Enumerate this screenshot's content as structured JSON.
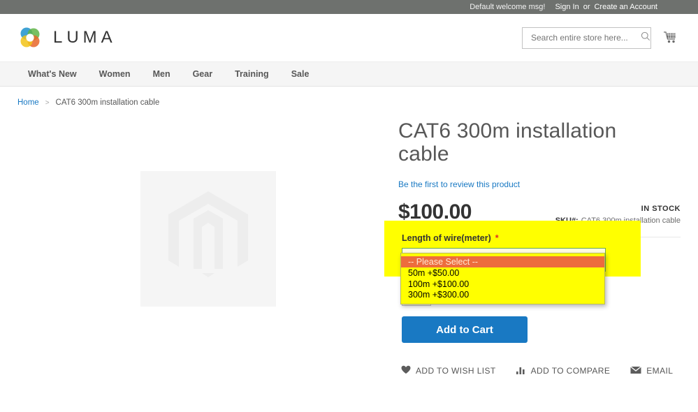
{
  "top_panel": {
    "welcome": "Default welcome msg!",
    "sign_in": "Sign In",
    "or": "or",
    "create_account": "Create an Account"
  },
  "header": {
    "brand": "LUMA",
    "search": {
      "placeholder": "Search entire store here...",
      "value": "",
      "icon": "search-icon"
    },
    "cart_icon": "shopping-cart-icon"
  },
  "nav": {
    "items": [
      {
        "label": "What's New"
      },
      {
        "label": "Women"
      },
      {
        "label": "Men"
      },
      {
        "label": "Gear"
      },
      {
        "label": "Training"
      },
      {
        "label": "Sale"
      }
    ]
  },
  "breadcrumb": {
    "home": "Home",
    "separator": ">",
    "current": "CAT6 300m installation cable"
  },
  "product": {
    "title": "CAT6 300m installation cable",
    "review_link": "Be the first to review this product",
    "price": "$100.00",
    "stock_status": "IN STOCK",
    "sku_label": "SKU#:",
    "sku_value": "CAT6 300m installation cable",
    "gallery_placeholder_icon": "magento-placeholder-icon"
  },
  "options": {
    "label": "Length of wire(meter)",
    "required_mark": "*",
    "select": {
      "selected_value": "-- Please Select --",
      "open": true,
      "options": [
        {
          "label": "-- Please Select --",
          "selected": true
        },
        {
          "label": "50m +$50.00",
          "selected": false
        },
        {
          "label": "100m +$100.00",
          "selected": false
        },
        {
          "label": "300m +$300.00",
          "selected": false
        }
      ]
    },
    "highlight_color": "#ffff00",
    "selected_option_color": "#ed6c3d",
    "focus_border_color": "#6aa84f"
  },
  "quantity": {
    "value": ""
  },
  "actions": {
    "add_to_cart": "Add to Cart",
    "add_to_cart_color": "#1979c3",
    "wishlist": "ADD TO WISH LIST",
    "wishlist_icon": "heart-icon",
    "compare": "ADD TO COMPARE",
    "compare_icon": "bar-chart-icon",
    "email": "EMAIL",
    "email_icon": "envelope-icon"
  }
}
